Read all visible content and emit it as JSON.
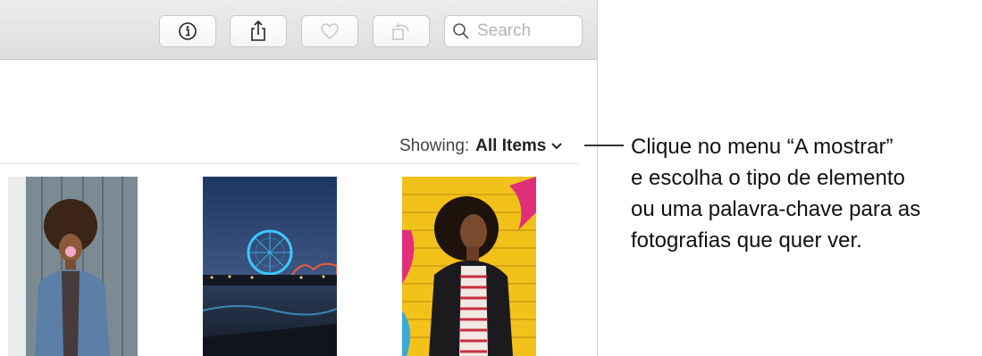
{
  "toolbar": {
    "buttons": [
      {
        "name": "info-button",
        "icon": "info-icon"
      },
      {
        "name": "share-button",
        "icon": "share-icon"
      },
      {
        "name": "favorite-button",
        "icon": "heart-icon"
      },
      {
        "name": "rotate-button",
        "icon": "rotate-icon"
      }
    ],
    "search": {
      "placeholder": "Search",
      "icon": "search-icon"
    }
  },
  "filter": {
    "label": "Showing:",
    "value": "All Items",
    "icon": "chevron-down-icon"
  },
  "photos": [
    {
      "subject": "person-blowing-bubble-gum",
      "icon": "photo-thumbnail"
    },
    {
      "subject": "pier-ferris-wheel-night",
      "icon": "photo-thumbnail"
    },
    {
      "subject": "person-leather-jacket-yellow-wall",
      "icon": "photo-thumbnail"
    }
  ],
  "callout": {
    "lines": [
      "Clique no menu “A mostrar”",
      "e escolha o tipo de elemento",
      "ou uma palavra-chave para as",
      "fotografias que quer ver."
    ]
  },
  "colors": {
    "toolbar_bg": "#e4e4e4",
    "window_bg": "#ffffff",
    "text": "#222222",
    "placeholder": "#b4b4b4"
  }
}
